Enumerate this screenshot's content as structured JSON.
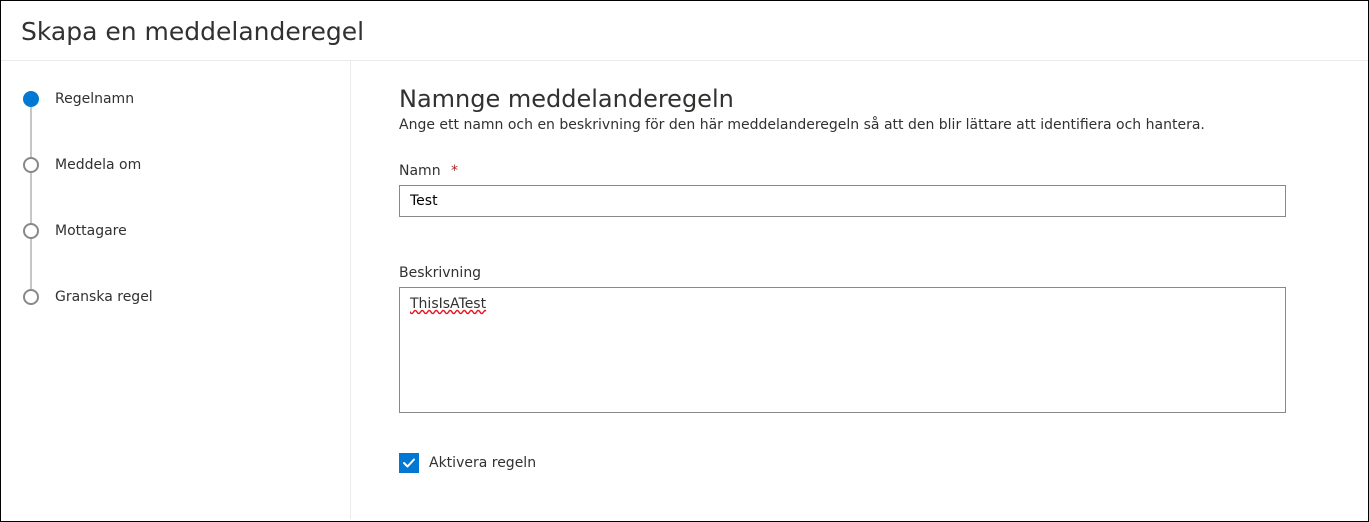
{
  "header": {
    "title": "Skapa en meddelanderegel"
  },
  "steps": [
    {
      "label": "Regelnamn",
      "active": true
    },
    {
      "label": "Meddela om",
      "active": false
    },
    {
      "label": "Mottagare",
      "active": false
    },
    {
      "label": "Granska regel",
      "active": false
    }
  ],
  "main": {
    "title": "Namnge meddelanderegeln",
    "subtitle": "Ange ett namn och en beskrivning för den här meddelanderegeln så att den blir lättare att identifiera och hantera.",
    "name_label": "Namn",
    "name_required_mark": "*",
    "name_value": "Test",
    "desc_label": "Beskrivning",
    "desc_value": "ThisIsATest",
    "activate_label": "Aktivera regeln",
    "activate_checked": true
  }
}
